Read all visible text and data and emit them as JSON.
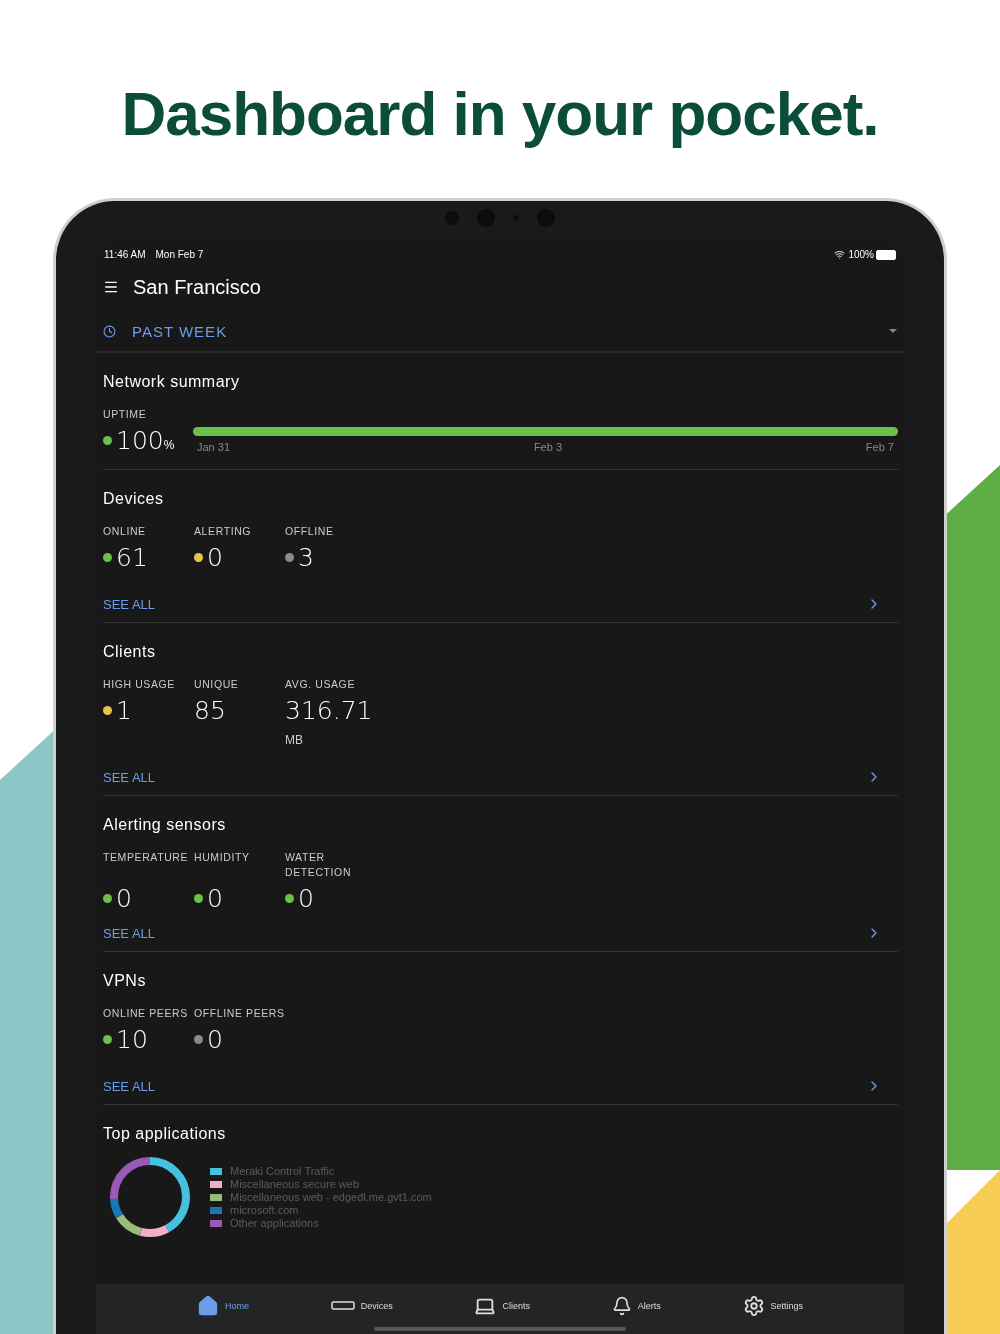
{
  "headline": "Dashboard in your pocket.",
  "status_bar": {
    "time": "11:46 AM",
    "date": "Mon Feb 7",
    "battery": "100%"
  },
  "header": {
    "title": "San Francisco"
  },
  "time_range": {
    "label": "PAST WEEK"
  },
  "network_summary": {
    "title": "Network summary",
    "label": "UPTIME",
    "value": "100",
    "unit": "%",
    "level": 1,
    "axis_labels": [
      "Jan 31",
      "Feb 3",
      "Feb 7"
    ]
  },
  "sections": [
    {
      "title": "Devices",
      "metrics": [
        {
          "label": "ONLINE",
          "value": "61",
          "color": "#6cc04a"
        },
        {
          "label": "ALERTING",
          "value": "0",
          "color": "#e8c547"
        },
        {
          "label": "OFFLINE",
          "value": "3",
          "color": "#8a8a8a"
        }
      ],
      "link": "SEE ALL"
    },
    {
      "title": "Clients",
      "metrics": [
        {
          "label": "HIGH USAGE",
          "value": "1",
          "color": "#e8c547"
        },
        {
          "label": "UNIQUE",
          "value": "85"
        },
        {
          "label": "AVG. USAGE",
          "value": "316.71",
          "unit": "MB"
        }
      ],
      "link": "SEE ALL"
    },
    {
      "title": "Alerting sensors",
      "metrics": [
        {
          "label": "TEMPERATURE",
          "value": "0",
          "color": "#6cc04a"
        },
        {
          "label": "HUMIDITY",
          "value": "0",
          "color": "#6cc04a"
        },
        {
          "label": "WATER DETECTION",
          "value": "0",
          "color": "#6cc04a"
        }
      ],
      "link": "SEE ALL"
    },
    {
      "title": "VPNs",
      "metrics": [
        {
          "label": "ONLINE PEERS",
          "value": "10",
          "color": "#6cc04a"
        },
        {
          "label": "OFFLINE PEERS",
          "value": "0",
          "color": "#8a8a8a"
        }
      ],
      "link": "SEE ALL"
    }
  ],
  "top_applications": {
    "title": "Top applications",
    "legend": [
      {
        "label": "Meraki Control Traffic",
        "color": "#45c0df"
      },
      {
        "label": "Miscellaneous secure web",
        "color": "#f4afc8"
      },
      {
        "label": "Miscellaneous web - edgedl.me.gvt1.com",
        "color": "#9cbb76"
      },
      {
        "label": "microsoft.com",
        "color": "#1679b5"
      },
      {
        "label": "Other applications",
        "color": "#9b59b6"
      }
    ]
  },
  "nav": [
    {
      "label": "Home",
      "selected": true
    },
    {
      "label": "Devices",
      "selected": false
    },
    {
      "label": "Clients",
      "selected": false
    },
    {
      "label": "Alerts",
      "selected": false
    },
    {
      "label": "Settings",
      "selected": false
    }
  ]
}
